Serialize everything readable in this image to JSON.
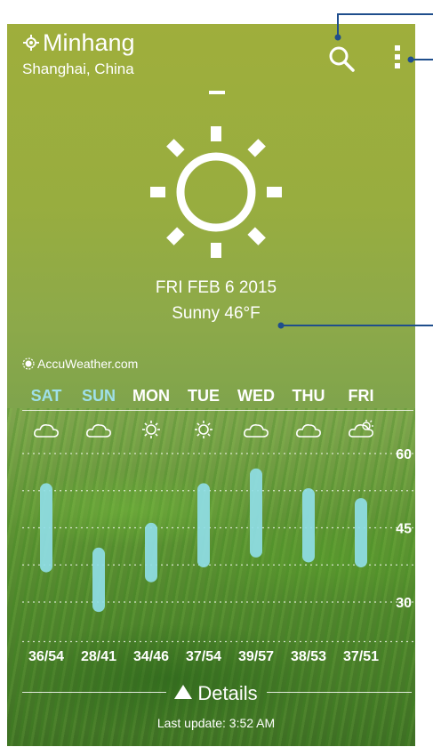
{
  "header": {
    "city": "Minhang",
    "region": "Shanghai, China"
  },
  "current": {
    "date": "FRI FEB 6 2015",
    "condition": "Sunny 46°F",
    "icon": "sun-icon"
  },
  "provider": "AccuWeather.com",
  "forecast": [
    {
      "day": "SAT",
      "weekend": true,
      "icon": "cloud-icon",
      "range": "36/54",
      "low": 36,
      "high": 54
    },
    {
      "day": "SUN",
      "weekend": true,
      "icon": "cloud-icon",
      "range": "28/41",
      "low": 28,
      "high": 41
    },
    {
      "day": "MON",
      "weekend": false,
      "icon": "sun-icon",
      "range": "34/46",
      "low": 34,
      "high": 46
    },
    {
      "day": "TUE",
      "weekend": false,
      "icon": "sun-icon",
      "range": "37/54",
      "low": 37,
      "high": 54
    },
    {
      "day": "WED",
      "weekend": false,
      "icon": "cloud-icon",
      "range": "39/57",
      "low": 39,
      "high": 57
    },
    {
      "day": "THU",
      "weekend": false,
      "icon": "cloud-icon",
      "range": "38/53",
      "low": 38,
      "high": 53
    },
    {
      "day": "FRI",
      "weekend": false,
      "icon": "partly-cloudy-icon",
      "range": "37/51",
      "low": 37,
      "high": 51
    }
  ],
  "scale": {
    "labels": [
      "60",
      "45",
      "30"
    ],
    "values": [
      60,
      45,
      30
    ]
  },
  "footer": {
    "details_label": "Details",
    "last_update": "Last update: 3:52 AM"
  },
  "colors": {
    "bar": "#8fdde6",
    "weekend_text": "#9fe0ea",
    "callout": "#1f4e8c"
  }
}
